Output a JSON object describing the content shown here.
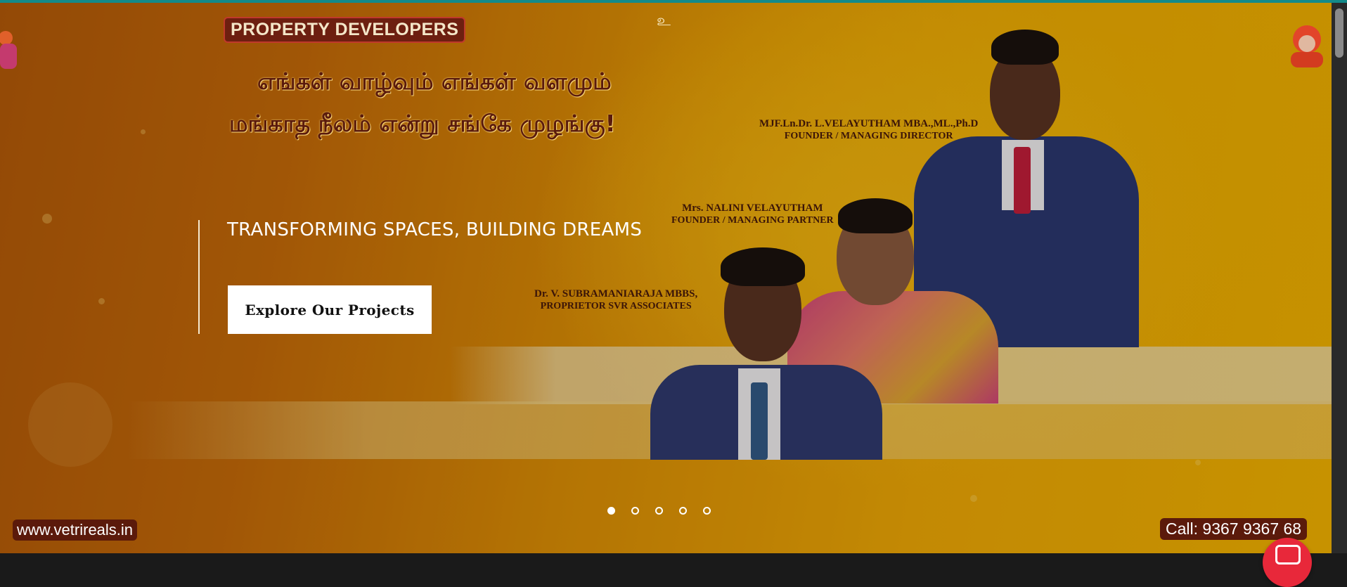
{
  "banner": {
    "tag": "PROPERTY DEVELOPERS",
    "tamil_line_1": "எங்கள் வாழ்வும் எங்கள் வளமும்",
    "tamil_line_2": "மங்காத நீலம் என்று சங்கே முழங்கு!",
    "people": [
      {
        "name": "MJF.Ln.Dr. L.VELAYUTHAM MBA.,ML.,Ph.D",
        "role": "FOUNDER / MANAGING DIRECTOR"
      },
      {
        "name": "Mrs. NALINI VELAYUTHAM",
        "role": "FOUNDER / MANAGING PARTNER"
      },
      {
        "name": "Dr. V. SUBRAMANIARAJA MBBS,",
        "role": "PROPRIETOR SVR ASSOCIATES"
      }
    ],
    "website": "www.vetrireals.in",
    "phone": "Call: 9367 9367 68"
  },
  "hero": {
    "headline": "TRANSFORMING SPACES, BUILDING DREAMS",
    "cta_label": "Explore Our Projects"
  },
  "carousel": {
    "active_index": 0,
    "slide_count": 5
  },
  "icons": {
    "chat": "chat-icon",
    "sai": "sai-baba-icon",
    "deity": "deity-icon"
  },
  "colors": {
    "cta_background": "#ffffff",
    "accent_top": "#138a8a",
    "chat_button": "#e8283a"
  }
}
